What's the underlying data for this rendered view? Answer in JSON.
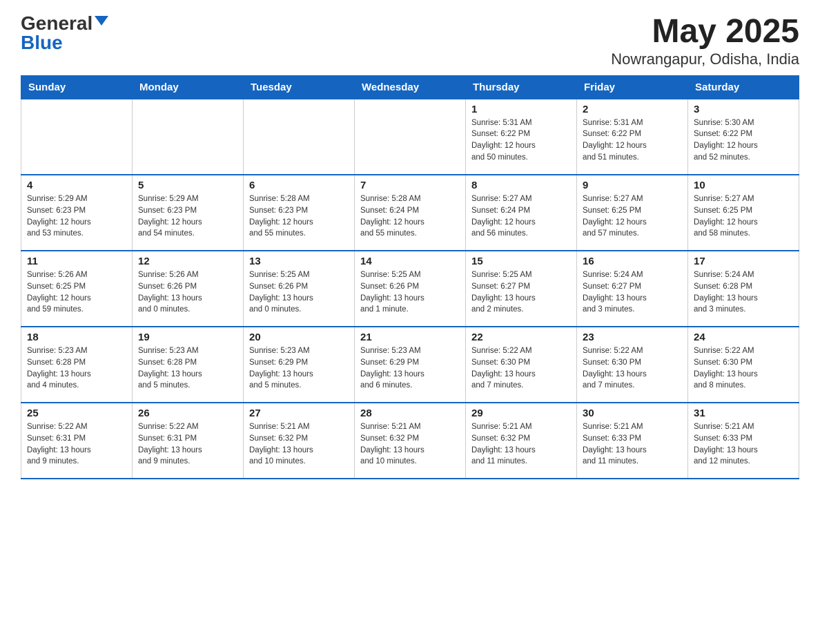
{
  "header": {
    "logo_general": "General",
    "logo_blue": "Blue",
    "month_year": "May 2025",
    "location": "Nowrangapur, Odisha, India"
  },
  "days_of_week": [
    "Sunday",
    "Monday",
    "Tuesday",
    "Wednesday",
    "Thursday",
    "Friday",
    "Saturday"
  ],
  "weeks": [
    [
      {
        "day": "",
        "info": ""
      },
      {
        "day": "",
        "info": ""
      },
      {
        "day": "",
        "info": ""
      },
      {
        "day": "",
        "info": ""
      },
      {
        "day": "1",
        "info": "Sunrise: 5:31 AM\nSunset: 6:22 PM\nDaylight: 12 hours\nand 50 minutes."
      },
      {
        "day": "2",
        "info": "Sunrise: 5:31 AM\nSunset: 6:22 PM\nDaylight: 12 hours\nand 51 minutes."
      },
      {
        "day": "3",
        "info": "Sunrise: 5:30 AM\nSunset: 6:22 PM\nDaylight: 12 hours\nand 52 minutes."
      }
    ],
    [
      {
        "day": "4",
        "info": "Sunrise: 5:29 AM\nSunset: 6:23 PM\nDaylight: 12 hours\nand 53 minutes."
      },
      {
        "day": "5",
        "info": "Sunrise: 5:29 AM\nSunset: 6:23 PM\nDaylight: 12 hours\nand 54 minutes."
      },
      {
        "day": "6",
        "info": "Sunrise: 5:28 AM\nSunset: 6:23 PM\nDaylight: 12 hours\nand 55 minutes."
      },
      {
        "day": "7",
        "info": "Sunrise: 5:28 AM\nSunset: 6:24 PM\nDaylight: 12 hours\nand 55 minutes."
      },
      {
        "day": "8",
        "info": "Sunrise: 5:27 AM\nSunset: 6:24 PM\nDaylight: 12 hours\nand 56 minutes."
      },
      {
        "day": "9",
        "info": "Sunrise: 5:27 AM\nSunset: 6:25 PM\nDaylight: 12 hours\nand 57 minutes."
      },
      {
        "day": "10",
        "info": "Sunrise: 5:27 AM\nSunset: 6:25 PM\nDaylight: 12 hours\nand 58 minutes."
      }
    ],
    [
      {
        "day": "11",
        "info": "Sunrise: 5:26 AM\nSunset: 6:25 PM\nDaylight: 12 hours\nand 59 minutes."
      },
      {
        "day": "12",
        "info": "Sunrise: 5:26 AM\nSunset: 6:26 PM\nDaylight: 13 hours\nand 0 minutes."
      },
      {
        "day": "13",
        "info": "Sunrise: 5:25 AM\nSunset: 6:26 PM\nDaylight: 13 hours\nand 0 minutes."
      },
      {
        "day": "14",
        "info": "Sunrise: 5:25 AM\nSunset: 6:26 PM\nDaylight: 13 hours\nand 1 minute."
      },
      {
        "day": "15",
        "info": "Sunrise: 5:25 AM\nSunset: 6:27 PM\nDaylight: 13 hours\nand 2 minutes."
      },
      {
        "day": "16",
        "info": "Sunrise: 5:24 AM\nSunset: 6:27 PM\nDaylight: 13 hours\nand 3 minutes."
      },
      {
        "day": "17",
        "info": "Sunrise: 5:24 AM\nSunset: 6:28 PM\nDaylight: 13 hours\nand 3 minutes."
      }
    ],
    [
      {
        "day": "18",
        "info": "Sunrise: 5:23 AM\nSunset: 6:28 PM\nDaylight: 13 hours\nand 4 minutes."
      },
      {
        "day": "19",
        "info": "Sunrise: 5:23 AM\nSunset: 6:28 PM\nDaylight: 13 hours\nand 5 minutes."
      },
      {
        "day": "20",
        "info": "Sunrise: 5:23 AM\nSunset: 6:29 PM\nDaylight: 13 hours\nand 5 minutes."
      },
      {
        "day": "21",
        "info": "Sunrise: 5:23 AM\nSunset: 6:29 PM\nDaylight: 13 hours\nand 6 minutes."
      },
      {
        "day": "22",
        "info": "Sunrise: 5:22 AM\nSunset: 6:30 PM\nDaylight: 13 hours\nand 7 minutes."
      },
      {
        "day": "23",
        "info": "Sunrise: 5:22 AM\nSunset: 6:30 PM\nDaylight: 13 hours\nand 7 minutes."
      },
      {
        "day": "24",
        "info": "Sunrise: 5:22 AM\nSunset: 6:30 PM\nDaylight: 13 hours\nand 8 minutes."
      }
    ],
    [
      {
        "day": "25",
        "info": "Sunrise: 5:22 AM\nSunset: 6:31 PM\nDaylight: 13 hours\nand 9 minutes."
      },
      {
        "day": "26",
        "info": "Sunrise: 5:22 AM\nSunset: 6:31 PM\nDaylight: 13 hours\nand 9 minutes."
      },
      {
        "day": "27",
        "info": "Sunrise: 5:21 AM\nSunset: 6:32 PM\nDaylight: 13 hours\nand 10 minutes."
      },
      {
        "day": "28",
        "info": "Sunrise: 5:21 AM\nSunset: 6:32 PM\nDaylight: 13 hours\nand 10 minutes."
      },
      {
        "day": "29",
        "info": "Sunrise: 5:21 AM\nSunset: 6:32 PM\nDaylight: 13 hours\nand 11 minutes."
      },
      {
        "day": "30",
        "info": "Sunrise: 5:21 AM\nSunset: 6:33 PM\nDaylight: 13 hours\nand 11 minutes."
      },
      {
        "day": "31",
        "info": "Sunrise: 5:21 AM\nSunset: 6:33 PM\nDaylight: 13 hours\nand 12 minutes."
      }
    ]
  ]
}
